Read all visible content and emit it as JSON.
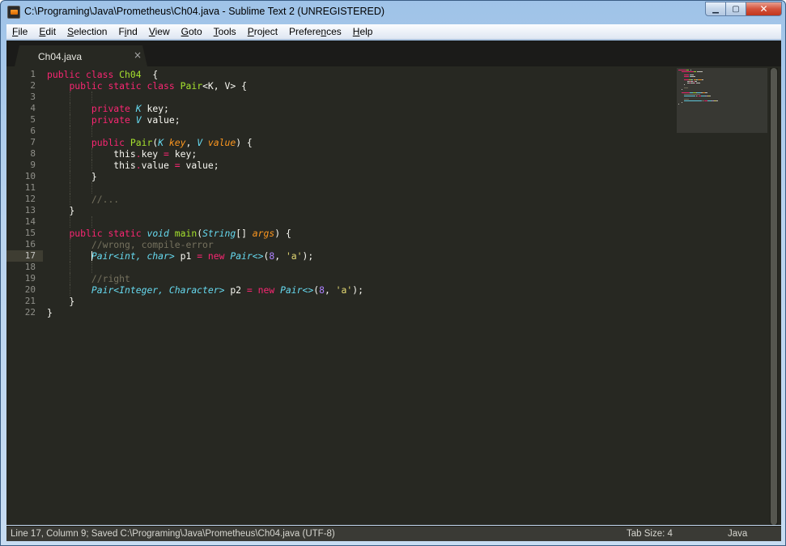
{
  "window": {
    "title": "C:\\Programing\\Java\\Prometheus\\Ch04.java - Sublime Text 2 (UNREGISTERED)",
    "controls": {
      "minimize": "▁",
      "maximize": "▢",
      "close": "✕"
    }
  },
  "menu": [
    {
      "label": "File",
      "access": "F",
      "rest": "ile"
    },
    {
      "label": "Edit",
      "access": "E",
      "rest": "dit"
    },
    {
      "label": "Selection",
      "access": "S",
      "rest": "election"
    },
    {
      "label": "Find",
      "access": "F",
      "rest": "i",
      "post": "nd"
    },
    {
      "label": "View",
      "access": "V",
      "rest": "iew"
    },
    {
      "label": "Goto",
      "access": "G",
      "rest": "oto"
    },
    {
      "label": "Tools",
      "access": "T",
      "rest": "ools"
    },
    {
      "label": "Project",
      "access": "P",
      "rest": "roject"
    },
    {
      "label": "Preferences",
      "access": "n",
      "pre": "Prefere",
      "rest": "ces"
    },
    {
      "label": "Help",
      "access": "H",
      "rest": "elp"
    }
  ],
  "tab": {
    "label": "Ch04.java",
    "close": "×"
  },
  "editor": {
    "current_line": 17,
    "lines": [
      [
        [
          "kw",
          "public "
        ],
        [
          "kw",
          "class "
        ],
        [
          "cls",
          "Ch04"
        ],
        [
          "",
          "  {"
        ]
      ],
      [
        [
          "",
          "    "
        ],
        [
          "kw",
          "public "
        ],
        [
          "kw",
          "static "
        ],
        [
          "kw",
          "class "
        ],
        [
          "cls",
          "Pair"
        ],
        [
          "",
          "<K, V> {"
        ]
      ],
      [
        [
          "",
          ""
        ]
      ],
      [
        [
          "",
          "        "
        ],
        [
          "kw",
          "private "
        ],
        [
          "tp",
          "K"
        ],
        [
          "",
          " key;"
        ]
      ],
      [
        [
          "",
          "        "
        ],
        [
          "kw",
          "private "
        ],
        [
          "tp",
          "V"
        ],
        [
          "",
          " value;"
        ]
      ],
      [
        [
          "",
          ""
        ]
      ],
      [
        [
          "",
          "        "
        ],
        [
          "kw",
          "public "
        ],
        [
          "cls",
          "Pair"
        ],
        [
          "",
          "("
        ],
        [
          "tp",
          "K"
        ],
        [
          "",
          " "
        ],
        [
          "par",
          "key"
        ],
        [
          "",
          ", "
        ],
        [
          "tp",
          "V"
        ],
        [
          "",
          " "
        ],
        [
          "par",
          "value"
        ],
        [
          "",
          ") {"
        ]
      ],
      [
        [
          "",
          "            this"
        ],
        [
          "kw",
          "."
        ],
        [
          "",
          "key "
        ],
        [
          "kw",
          "="
        ],
        [
          "",
          " key;"
        ]
      ],
      [
        [
          "",
          "            this"
        ],
        [
          "kw",
          "."
        ],
        [
          "",
          "value "
        ],
        [
          "kw",
          "="
        ],
        [
          "",
          " value;"
        ]
      ],
      [
        [
          "",
          "        }"
        ]
      ],
      [
        [
          "",
          ""
        ]
      ],
      [
        [
          "",
          "        "
        ],
        [
          "cmt",
          "//..."
        ]
      ],
      [
        [
          "",
          "    }"
        ]
      ],
      [
        [
          "",
          ""
        ]
      ],
      [
        [
          "",
          "    "
        ],
        [
          "kw",
          "public "
        ],
        [
          "kw",
          "static "
        ],
        [
          "tp",
          "void "
        ],
        [
          "cls",
          "main"
        ],
        [
          "",
          "("
        ],
        [
          "tp",
          "String"
        ],
        [
          "",
          "[] "
        ],
        [
          "par",
          "args"
        ],
        [
          "",
          ") {"
        ]
      ],
      [
        [
          "",
          "        "
        ],
        [
          "cmt",
          "//wrong, compile-error"
        ]
      ],
      [
        [
          "",
          "        "
        ],
        [
          "tp",
          "Pair<int, char>"
        ],
        [
          "",
          " p1 "
        ],
        [
          "kw",
          "="
        ],
        [
          "",
          " "
        ],
        [
          "kw",
          "new "
        ],
        [
          "tp",
          "Pair<>"
        ],
        [
          "",
          "("
        ],
        [
          "num",
          "8"
        ],
        [
          "",
          ", "
        ],
        [
          "str",
          "'a'"
        ],
        [
          "",
          ");"
        ]
      ],
      [
        [
          "",
          ""
        ]
      ],
      [
        [
          "",
          "        "
        ],
        [
          "cmt",
          "//right"
        ]
      ],
      [
        [
          "",
          "        "
        ],
        [
          "tp",
          "Pair<Integer, Character>"
        ],
        [
          "",
          " p2 "
        ],
        [
          "kw",
          "="
        ],
        [
          "",
          " "
        ],
        [
          "kw",
          "new "
        ],
        [
          "tp",
          "Pair<>"
        ],
        [
          "",
          "("
        ],
        [
          "num",
          "8"
        ],
        [
          "",
          ", "
        ],
        [
          "str",
          "'a'"
        ],
        [
          "",
          ");"
        ]
      ],
      [
        [
          "",
          "    }"
        ]
      ],
      [
        [
          "",
          "}"
        ]
      ]
    ]
  },
  "status": {
    "position": "Line 17, Column 9; Saved C:\\Programing\\Java\\Prometheus\\Ch04.java (UTF-8)",
    "tab_size": "Tab Size: 4",
    "syntax": "Java"
  },
  "colors": {
    "background": "#272822",
    "keyword": "#f92672",
    "type": "#66d9ef",
    "class": "#a6e22e",
    "param": "#fd971f",
    "number": "#ae81ff",
    "string": "#e6db74",
    "comment": "#75715e"
  }
}
